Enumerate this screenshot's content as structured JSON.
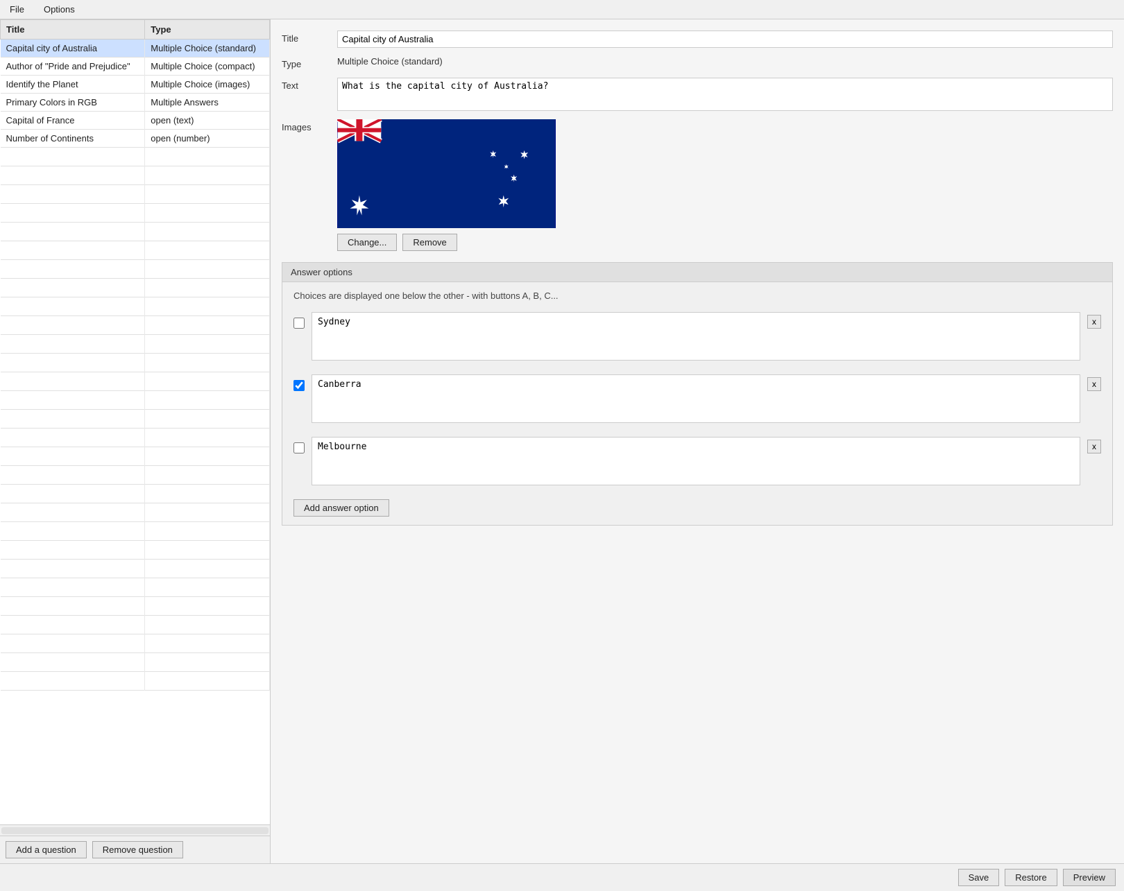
{
  "menubar": {
    "file_label": "File",
    "options_label": "Options"
  },
  "left_panel": {
    "table_headers": [
      "Title",
      "Type"
    ],
    "questions": [
      {
        "title": "Capital city of Australia",
        "type": "Multiple Choice (standard)",
        "selected": true
      },
      {
        "title": "Author of \"Pride and Prejudice\"",
        "type": "Multiple Choice (compact)",
        "selected": false
      },
      {
        "title": "Identify the Planet",
        "type": "Multiple Choice (images)",
        "selected": false
      },
      {
        "title": "Primary Colors in RGB",
        "type": "Multiple Answers",
        "selected": false
      },
      {
        "title": "Capital of France",
        "type": "open (text)",
        "selected": false
      },
      {
        "title": "Number of Continents",
        "type": "open (number)",
        "selected": false
      }
    ],
    "add_question_btn": "Add a question",
    "remove_question_btn": "Remove question"
  },
  "right_panel": {
    "title_label": "Title",
    "title_value": "Capital city of Australia",
    "type_label": "Type",
    "type_value": "Multiple Choice (standard)",
    "text_label": "Text",
    "text_value": "What is the capital city of Australia?",
    "images_label": "Images",
    "change_btn": "Change...",
    "remove_btn": "Remove",
    "answer_options_header": "Answer options",
    "choices_hint": "Choices are displayed one below the other - with buttons A, B, C...",
    "answers": [
      {
        "text": "Sydney",
        "correct": false
      },
      {
        "text": "Canberra",
        "correct": true
      },
      {
        "text": "Melbourne",
        "correct": false
      }
    ],
    "add_answer_btn": "Add answer option"
  },
  "bottom_bar": {
    "save_btn": "Save",
    "restore_btn": "Restore",
    "preview_btn": "Preview"
  }
}
